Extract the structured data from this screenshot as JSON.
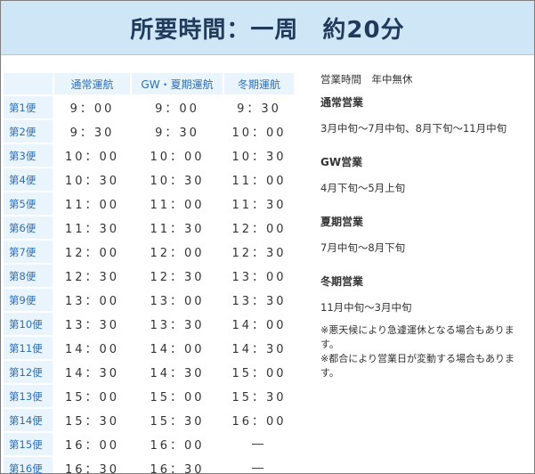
{
  "banner": {
    "title": "所要時間：一周　約20分"
  },
  "table": {
    "headers": [
      "通常運航",
      "GW・夏期運航",
      "冬期運航"
    ],
    "rows": [
      {
        "label": "第1便",
        "normal": "9：00",
        "gw_summer": "9：00",
        "winter": "9：30"
      },
      {
        "label": "第2便",
        "normal": "9：30",
        "gw_summer": "9：30",
        "winter": "10：00"
      },
      {
        "label": "第3便",
        "normal": "10：00",
        "gw_summer": "10：00",
        "winter": "10：30"
      },
      {
        "label": "第4便",
        "normal": "10：30",
        "gw_summer": "10：30",
        "winter": "11：00"
      },
      {
        "label": "第5便",
        "normal": "11：00",
        "gw_summer": "11：00",
        "winter": "11：30"
      },
      {
        "label": "第6便",
        "normal": "11：30",
        "gw_summer": "11：30",
        "winter": "12：00"
      },
      {
        "label": "第7便",
        "normal": "12：00",
        "gw_summer": "12：00",
        "winter": "12：30"
      },
      {
        "label": "第8便",
        "normal": "12：30",
        "gw_summer": "12：30",
        "winter": "13：00"
      },
      {
        "label": "第9便",
        "normal": "13：00",
        "gw_summer": "13：00",
        "winter": "13：30"
      },
      {
        "label": "第10便",
        "normal": "13：30",
        "gw_summer": "13：30",
        "winter": "14：00"
      },
      {
        "label": "第11便",
        "normal": "14：00",
        "gw_summer": "14：00",
        "winter": "14：30"
      },
      {
        "label": "第12便",
        "normal": "14：30",
        "gw_summer": "14：30",
        "winter": "15：00"
      },
      {
        "label": "第13便",
        "normal": "15：00",
        "gw_summer": "15：00",
        "winter": "15：30"
      },
      {
        "label": "第14便",
        "normal": "15：30",
        "gw_summer": "15：30",
        "winter": "16：00"
      },
      {
        "label": "第15便",
        "normal": "16：00",
        "gw_summer": "16：00",
        "winter": "―"
      },
      {
        "label": "第16便",
        "normal": "16：30",
        "gw_summer": "16：30",
        "winter": "―"
      }
    ]
  },
  "info": {
    "hours": "営業時間　年中無休",
    "sections": [
      {
        "title": "通常営業",
        "body": "3月中旬～7月中旬、8月下旬～11月中旬"
      },
      {
        "title": "GW営業",
        "body": "4月下旬～5月上旬"
      },
      {
        "title": "夏期営業",
        "body": "7月中旬～8月下旬"
      },
      {
        "title": "冬期営業",
        "body": "11月中旬～3月中旬"
      }
    ],
    "notes": [
      {
        "line1": "※悪天候により急遽運休となる場合もありま",
        "line2": "す。"
      },
      {
        "line1": "※都合により営業日が変動する場合もありま",
        "line2": "す。"
      }
    ]
  }
}
